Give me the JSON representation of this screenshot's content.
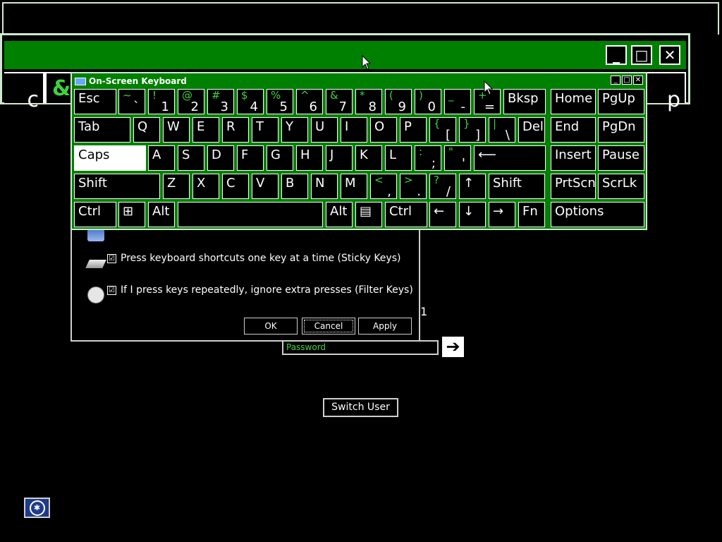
{
  "background_window": {
    "controls": [
      "_",
      "□",
      "✕"
    ],
    "partial_keys": [
      {
        "green": "",
        "white": "c"
      },
      {
        "green": "&",
        "white": ""
      },
      {
        "green": "",
        "white": "p"
      }
    ]
  },
  "osk": {
    "title": "On-Screen Keyboard",
    "controls": [
      "_",
      "□",
      "✕"
    ],
    "rows": [
      [
        {
          "label": "Esc"
        },
        {
          "top": "~",
          "bot": "`"
        },
        {
          "top": "!",
          "bot": "1"
        },
        {
          "top": "@",
          "bot": "2"
        },
        {
          "top": "#",
          "bot": "3"
        },
        {
          "top": "$",
          "bot": "4"
        },
        {
          "top": "%",
          "bot": "5"
        },
        {
          "top": "^",
          "bot": "6"
        },
        {
          "top": "&",
          "bot": "7"
        },
        {
          "top": "*",
          "bot": "8"
        },
        {
          "top": "(",
          "bot": "9"
        },
        {
          "top": ")",
          "bot": "0"
        },
        {
          "top": "_",
          "bot": "-"
        },
        {
          "top": "+",
          "bot": "="
        },
        {
          "label": "Bksp"
        },
        {
          "label": "Home"
        },
        {
          "label": "PgUp"
        }
      ],
      [
        {
          "label": "Tab"
        },
        {
          "label": "Q"
        },
        {
          "label": "W"
        },
        {
          "label": "E"
        },
        {
          "label": "R"
        },
        {
          "label": "T"
        },
        {
          "label": "Y"
        },
        {
          "label": "U"
        },
        {
          "label": "I"
        },
        {
          "label": "O"
        },
        {
          "label": "P"
        },
        {
          "top": "{",
          "bot": "["
        },
        {
          "top": "}",
          "bot": "]"
        },
        {
          "top": "|",
          "bot": "\\"
        },
        {
          "label": "Del"
        },
        {
          "label": "End"
        },
        {
          "label": "PgDn"
        }
      ],
      [
        {
          "label": "Caps"
        },
        {
          "label": "A"
        },
        {
          "label": "S"
        },
        {
          "label": "D"
        },
        {
          "label": "F"
        },
        {
          "label": "G"
        },
        {
          "label": "H"
        },
        {
          "label": "J"
        },
        {
          "label": "K"
        },
        {
          "label": "L"
        },
        {
          "top": ":",
          "bot": ";"
        },
        {
          "top": "\"",
          "bot": "'"
        },
        {
          "label": "⟵"
        },
        {
          "label": "Insert"
        },
        {
          "label": "Pause"
        }
      ],
      [
        {
          "label": "Shift"
        },
        {
          "label": "Z"
        },
        {
          "label": "X"
        },
        {
          "label": "C"
        },
        {
          "label": "V"
        },
        {
          "label": "B"
        },
        {
          "label": "N"
        },
        {
          "label": "M"
        },
        {
          "top": "<",
          "bot": ","
        },
        {
          "top": ">",
          "bot": "."
        },
        {
          "top": "?",
          "bot": "/"
        },
        {
          "label": "↑"
        },
        {
          "label": "Shift"
        },
        {
          "label": "PrtScn"
        },
        {
          "label": "ScrLk"
        }
      ],
      [
        {
          "label": "Ctrl"
        },
        {
          "label": "⊞"
        },
        {
          "label": "Alt"
        },
        {
          "label": ""
        },
        {
          "label": "Alt"
        },
        {
          "label": "▤"
        },
        {
          "label": "Ctrl"
        },
        {
          "label": "←"
        },
        {
          "label": "↓"
        },
        {
          "label": "→"
        },
        {
          "label": "Fn"
        },
        {
          "label": "Options"
        }
      ]
    ]
  },
  "dialog": {
    "options": [
      {
        "label": "Press keyboard shortcuts one key at a time (Sticky Keys)",
        "checked": "☑"
      },
      {
        "label": "If I press keys repeatedly, ignore extra presses (Filter Keys)",
        "checked": "☑"
      }
    ],
    "buttons": {
      "ok": "OK",
      "cancel": "Cancel",
      "apply": "Apply"
    }
  },
  "login": {
    "password_placeholder": "Password",
    "go_label": "➔",
    "switch_user": "Switch User",
    "stray_char": "1"
  },
  "colors": {
    "accent": "#008000",
    "key_green": "#3fd13f"
  }
}
